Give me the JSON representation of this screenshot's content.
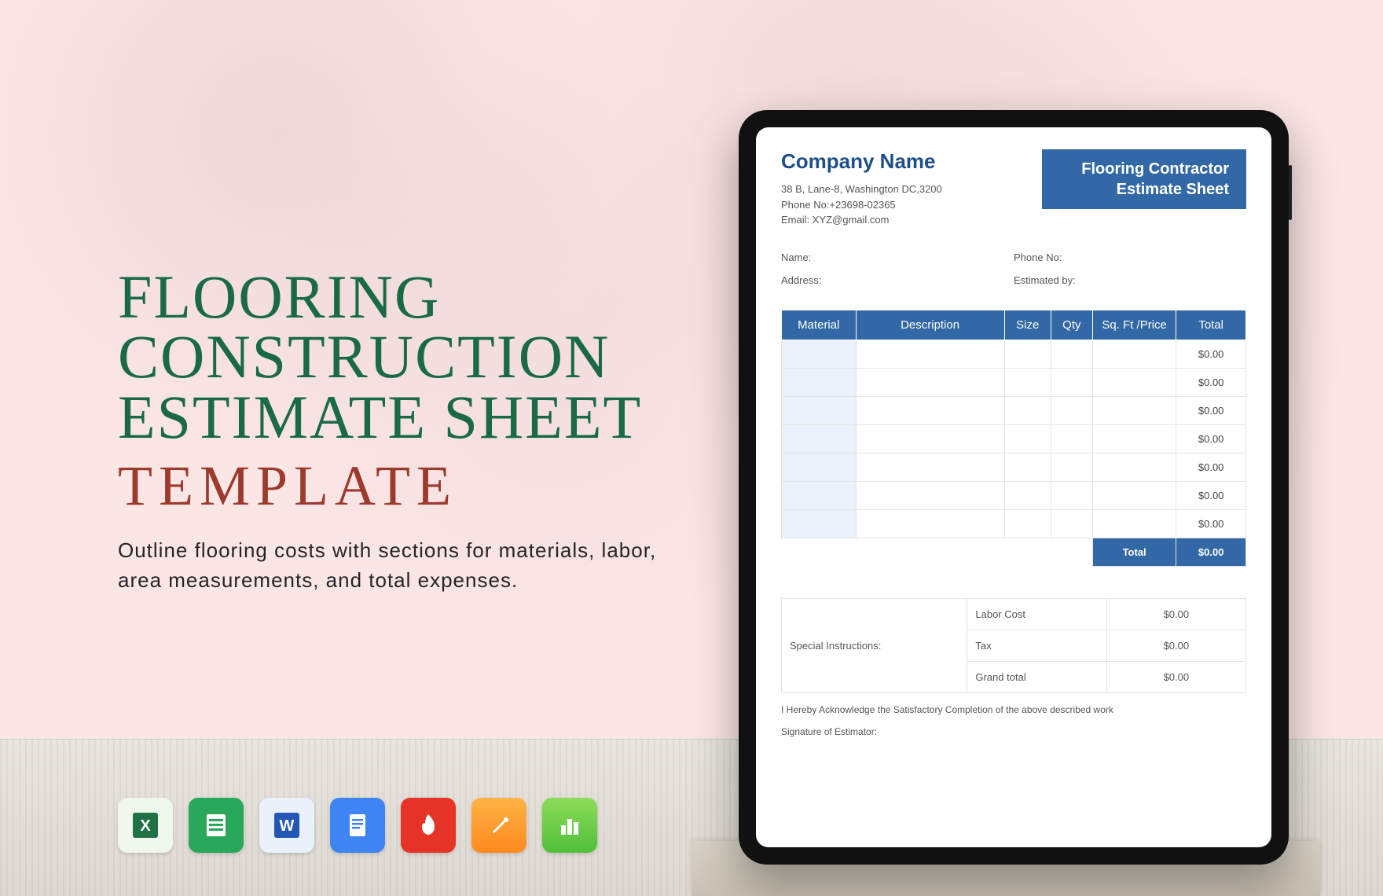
{
  "promo": {
    "title_line1": "FLOORING",
    "title_line2": "CONSTRUCTION",
    "title_line3": "ESTIMATE SHEET",
    "subtitle": "TEMPLATE",
    "description": "Outline flooring costs with sections for materials, labor, area measurements, and total expenses."
  },
  "icons": {
    "excel": "excel-icon",
    "sheets": "google-sheets-icon",
    "word": "word-icon",
    "docs": "google-docs-icon",
    "pdf": "pdf-icon",
    "pages": "apple-pages-icon",
    "numbers": "apple-numbers-icon"
  },
  "document": {
    "company_name": "Company Name",
    "address": "38 B, Lane-8, Washington DC,3200",
    "phone": "Phone No:+23698-02365",
    "email": "Email: XYZ@gmail.com",
    "badge_line1": "Flooring Contractor",
    "badge_line2": "Estimate Sheet",
    "client": {
      "name_label": "Name:",
      "phone_label": "Phone No:",
      "address_label": "Address:",
      "estimated_by_label": "Estimated by:"
    },
    "table": {
      "headers": [
        "Material",
        "Description",
        "Size",
        "Qty",
        "Sq. Ft /Price",
        "Total"
      ],
      "rows": [
        {
          "total": "$0.00"
        },
        {
          "total": "$0.00"
        },
        {
          "total": "$0.00"
        },
        {
          "total": "$0.00"
        },
        {
          "total": "$0.00"
        },
        {
          "total": "$0.00"
        },
        {
          "total": "$0.00"
        }
      ],
      "footer_label": "Total",
      "footer_value": "$0.00"
    },
    "summary": {
      "special_label": "Special Instructions:",
      "labor_label": "Labor Cost",
      "labor_value": "$0.00",
      "tax_label": "Tax",
      "tax_value": "$0.00",
      "grand_label": "Grand total",
      "grand_value": "$0.00"
    },
    "acknowledgement": "I Hereby Acknowledge the Satisfactory Completion of the above described work",
    "signature_label": "Signature of Estimator:"
  }
}
